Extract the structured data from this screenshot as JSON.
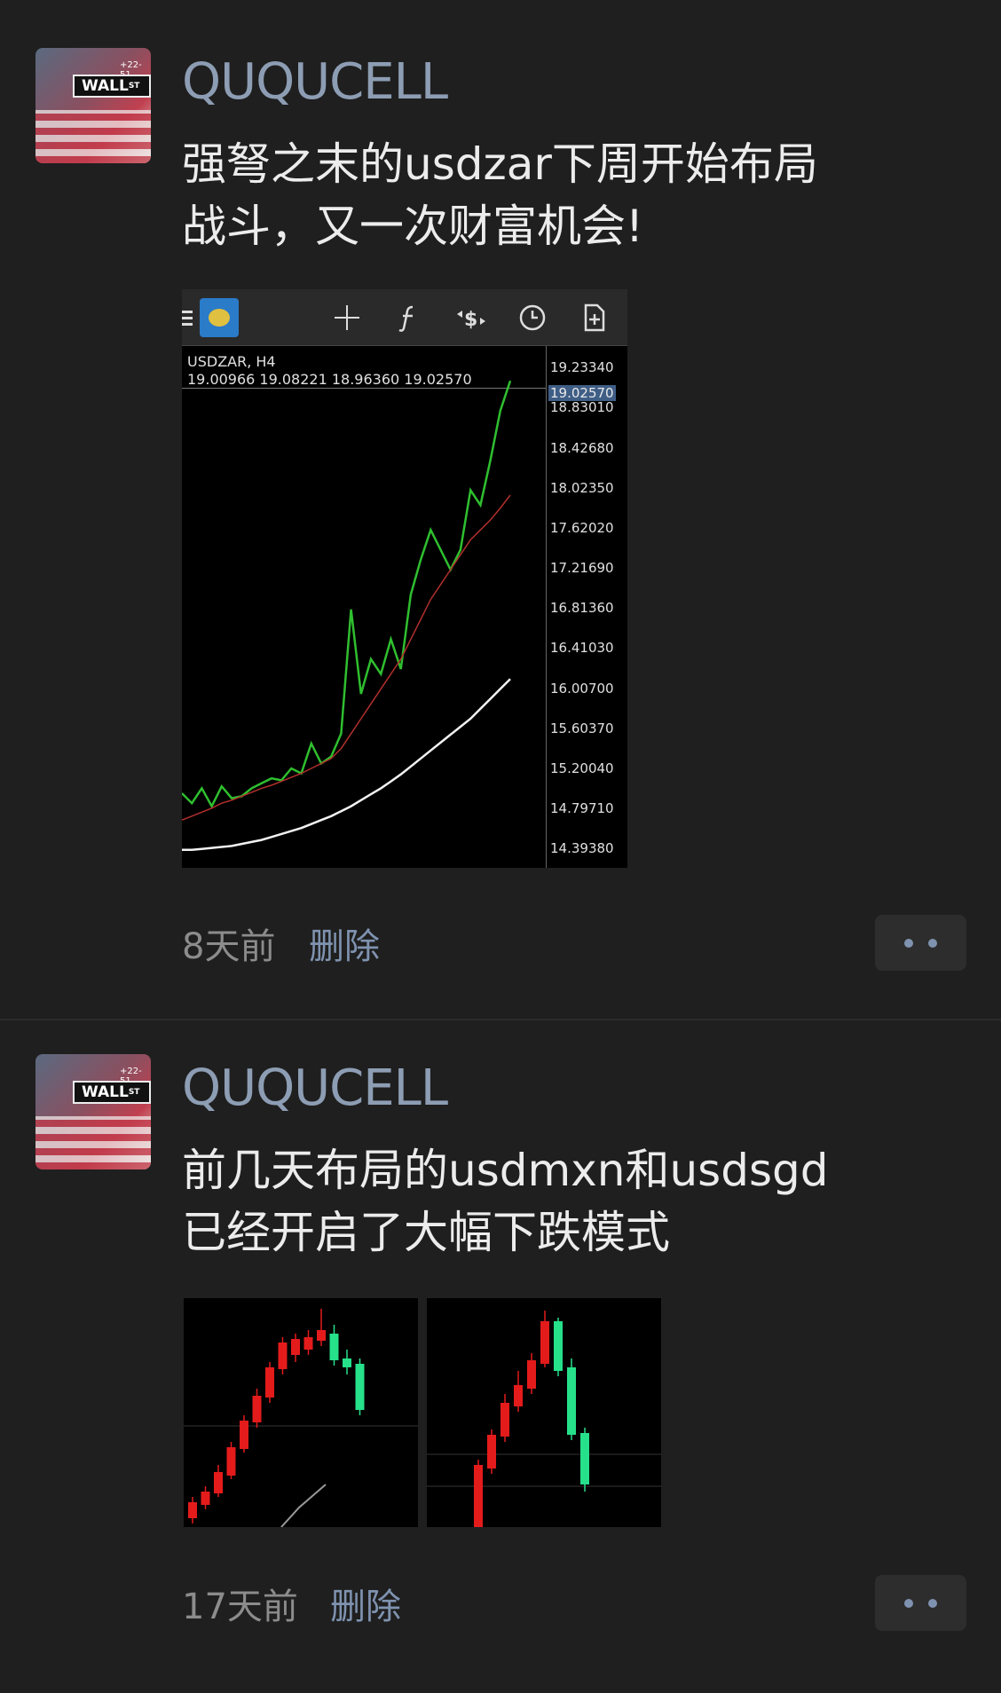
{
  "posts": [
    {
      "username": "QUQUCELL",
      "avatar_sign": "WALL",
      "avatar_sign_sup": "ST",
      "avatar_caption": "+22-51",
      "text_line1": "强弩之末的usdzar下周开始布局",
      "text_line2": "战斗，又一次财富机会!",
      "time": "8天前",
      "delete_label": "删除"
    },
    {
      "username": "QUQUCELL",
      "avatar_sign": "WALL",
      "avatar_sign_sup": "ST",
      "avatar_caption": "+22-51",
      "text_line1": "前几天布局的usdmxn和usdsgd",
      "text_line2": "已经开启了大幅下跌模式",
      "time": "17天前",
      "delete_label": "删除"
    }
  ],
  "toolbar_icons": [
    "menu-icon",
    "metatrader-logo-icon",
    "crosshair-icon",
    "indicators-icon",
    "trade-icon",
    "clock-icon",
    "new-order-icon"
  ],
  "chart_data": {
    "type": "line",
    "title": "USDZAR, H4",
    "ohlc_label": "19.00966 19.08221 18.96360 19.02570",
    "current_price": "19.02570",
    "y_ticks": [
      "19.23340",
      "18.83010",
      "18.42680",
      "18.02350",
      "17.62020",
      "17.21690",
      "16.81360",
      "16.41030",
      "16.00700",
      "15.60370",
      "15.20040",
      "14.79710",
      "14.39380"
    ],
    "ylim": [
      14.2,
      19.45
    ],
    "series": [
      {
        "values": [
          14.95,
          14.85,
          15.0,
          14.82,
          15.02,
          14.9,
          14.92,
          15.0,
          15.05,
          15.1,
          15.08,
          15.2,
          15.15,
          15.45,
          15.25,
          15.32,
          15.55,
          16.8,
          15.95,
          16.3,
          16.15,
          16.5,
          16.2,
          16.95,
          17.3,
          17.6,
          17.4,
          17.2,
          17.4,
          18.0,
          17.85,
          18.3,
          18.8,
          19.1
        ]
      },
      {
        "values": [
          14.68,
          14.72,
          14.76,
          14.8,
          14.85,
          14.88,
          14.92,
          14.96,
          15.0,
          15.03,
          15.07,
          15.11,
          15.15,
          15.2,
          15.25,
          15.3,
          15.4,
          15.55,
          15.7,
          15.85,
          16.0,
          16.15,
          16.3,
          16.5,
          16.7,
          16.9,
          17.05,
          17.2,
          17.35,
          17.5,
          17.6,
          17.7,
          17.82,
          17.95
        ]
      },
      {
        "values": [
          14.38,
          14.38,
          14.39,
          14.4,
          14.41,
          14.42,
          14.44,
          14.46,
          14.48,
          14.51,
          14.54,
          14.57,
          14.6,
          14.64,
          14.68,
          14.72,
          14.77,
          14.82,
          14.88,
          14.94,
          15.0,
          15.07,
          15.14,
          15.22,
          15.3,
          15.38,
          15.46,
          15.54,
          15.62,
          15.7,
          15.8,
          15.9,
          16.0,
          16.1
        ]
      }
    ],
    "series_colors": [
      "#2fbf2f",
      "#b0302c",
      "#f2f2f2"
    ]
  },
  "thumbnails": [
    {
      "name": "usdmxn",
      "candles": [
        {
          "o": 10,
          "c": 28,
          "h": 34,
          "l": 4,
          "bull": true
        },
        {
          "o": 25,
          "c": 40,
          "h": 46,
          "l": 20,
          "bull": true
        },
        {
          "o": 38,
          "c": 62,
          "h": 70,
          "l": 34,
          "bull": true
        },
        {
          "o": 58,
          "c": 90,
          "h": 96,
          "l": 54,
          "bull": true
        },
        {
          "o": 88,
          "c": 120,
          "h": 126,
          "l": 84,
          "bull": true
        },
        {
          "o": 118,
          "c": 148,
          "h": 156,
          "l": 112,
          "bull": true
        },
        {
          "o": 146,
          "c": 180,
          "h": 186,
          "l": 140,
          "bull": true
        },
        {
          "o": 178,
          "c": 208,
          "h": 214,
          "l": 172,
          "bull": true
        },
        {
          "o": 194,
          "c": 212,
          "h": 218,
          "l": 186,
          "bull": true
        },
        {
          "o": 200,
          "c": 214,
          "h": 222,
          "l": 194,
          "bull": true
        },
        {
          "o": 210,
          "c": 222,
          "h": 246,
          "l": 204,
          "bull": true
        },
        {
          "o": 218,
          "c": 188,
          "h": 228,
          "l": 182,
          "bull": false
        },
        {
          "o": 190,
          "c": 180,
          "h": 200,
          "l": 172,
          "bull": false
        },
        {
          "o": 184,
          "c": 132,
          "h": 190,
          "l": 126,
          "bull": false
        }
      ]
    },
    {
      "name": "usdsgd",
      "candles": [
        {
          "o": 0,
          "c": 70,
          "h": 76,
          "l": 0,
          "bull": true
        },
        {
          "o": 66,
          "c": 104,
          "h": 110,
          "l": 60,
          "bull": true
        },
        {
          "o": 102,
          "c": 140,
          "h": 150,
          "l": 96,
          "bull": true
        },
        {
          "o": 136,
          "c": 160,
          "h": 176,
          "l": 130,
          "bull": true
        },
        {
          "o": 156,
          "c": 188,
          "h": 196,
          "l": 150,
          "bull": true
        },
        {
          "o": 184,
          "c": 232,
          "h": 244,
          "l": 180,
          "bull": true
        },
        {
          "o": 232,
          "c": 176,
          "h": 236,
          "l": 170,
          "bull": false
        },
        {
          "o": 180,
          "c": 104,
          "h": 190,
          "l": 98,
          "bull": false
        },
        {
          "o": 106,
          "c": 48,
          "h": 112,
          "l": 40,
          "bull": false
        }
      ]
    }
  ]
}
